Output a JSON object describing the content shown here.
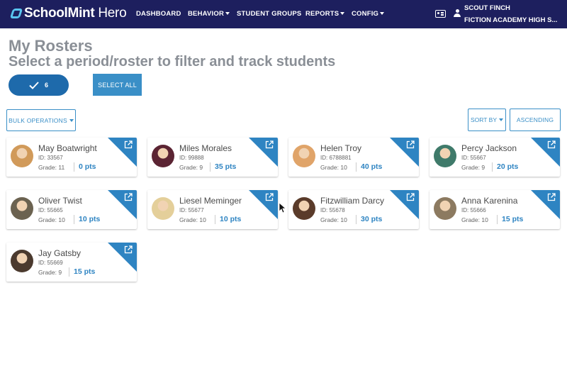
{
  "header": {
    "logo_bold": "SchoolMint",
    "logo_light": " Hero",
    "nav": [
      {
        "label": "DASHBOARD",
        "dropdown": false
      },
      {
        "label": "BEHAVIOR",
        "dropdown": true
      },
      {
        "label": "STUDENT GROUPS",
        "dropdown": false
      },
      {
        "label": "REPORTS",
        "dropdown": true
      },
      {
        "label": "CONFIG",
        "dropdown": true
      }
    ],
    "user_name": "SCOUT FINCH",
    "school_name": "FICTION ACADEMY HIGH S...",
    "bg_color": "#1d1f5e"
  },
  "page": {
    "title": "My Rosters",
    "subtitle": "Select a period/roster to filter and track students"
  },
  "toolbar": {
    "selected_count": "6",
    "select_all_label": "SELECT ALL",
    "bulk_label": "BULK OPERATIONS",
    "sort_label": "SORT BY",
    "order_label": "ASCENDING",
    "accent_color": "#2e84c2"
  },
  "students": [
    {
      "name": "May Boatwright",
      "id": "ID: 33567",
      "grade": "Grade: 11",
      "points": "0 pts",
      "avatar_color": "#d19a5a"
    },
    {
      "name": "Miles Morales",
      "id": "ID: 99888",
      "grade": "Grade: 9",
      "points": "35 pts",
      "avatar_color": "#5b2433"
    },
    {
      "name": "Helen Troy",
      "id": "ID: 6788881",
      "grade": "Grade: 10",
      "points": "40 pts",
      "avatar_color": "#e0a469"
    },
    {
      "name": "Percy Jackson",
      "id": "ID: 55667",
      "grade": "Grade: 9",
      "points": "20 pts",
      "avatar_color": "#3f7a6a"
    },
    {
      "name": "Oliver Twist",
      "id": "ID: 55665",
      "grade": "Grade: 10",
      "points": "10 pts",
      "avatar_color": "#6b6250"
    },
    {
      "name": "Liesel Meminger",
      "id": "ID: 55677",
      "grade": "Grade: 10",
      "points": "10 pts",
      "avatar_color": "#e4cf9a"
    },
    {
      "name": "Fitzwilliam Darcy",
      "id": "ID: 55678",
      "grade": "Grade: 10",
      "points": "30 pts",
      "avatar_color": "#5a3b2a"
    },
    {
      "name": "Anna Karenina",
      "id": "ID: 55666",
      "grade": "Grade: 10",
      "points": "15 pts",
      "avatar_color": "#8c7a60"
    },
    {
      "name": "Jay Gatsby",
      "id": "ID: 55669",
      "grade": "Grade: 9",
      "points": "15 pts",
      "avatar_color": "#4b3a2e"
    }
  ]
}
